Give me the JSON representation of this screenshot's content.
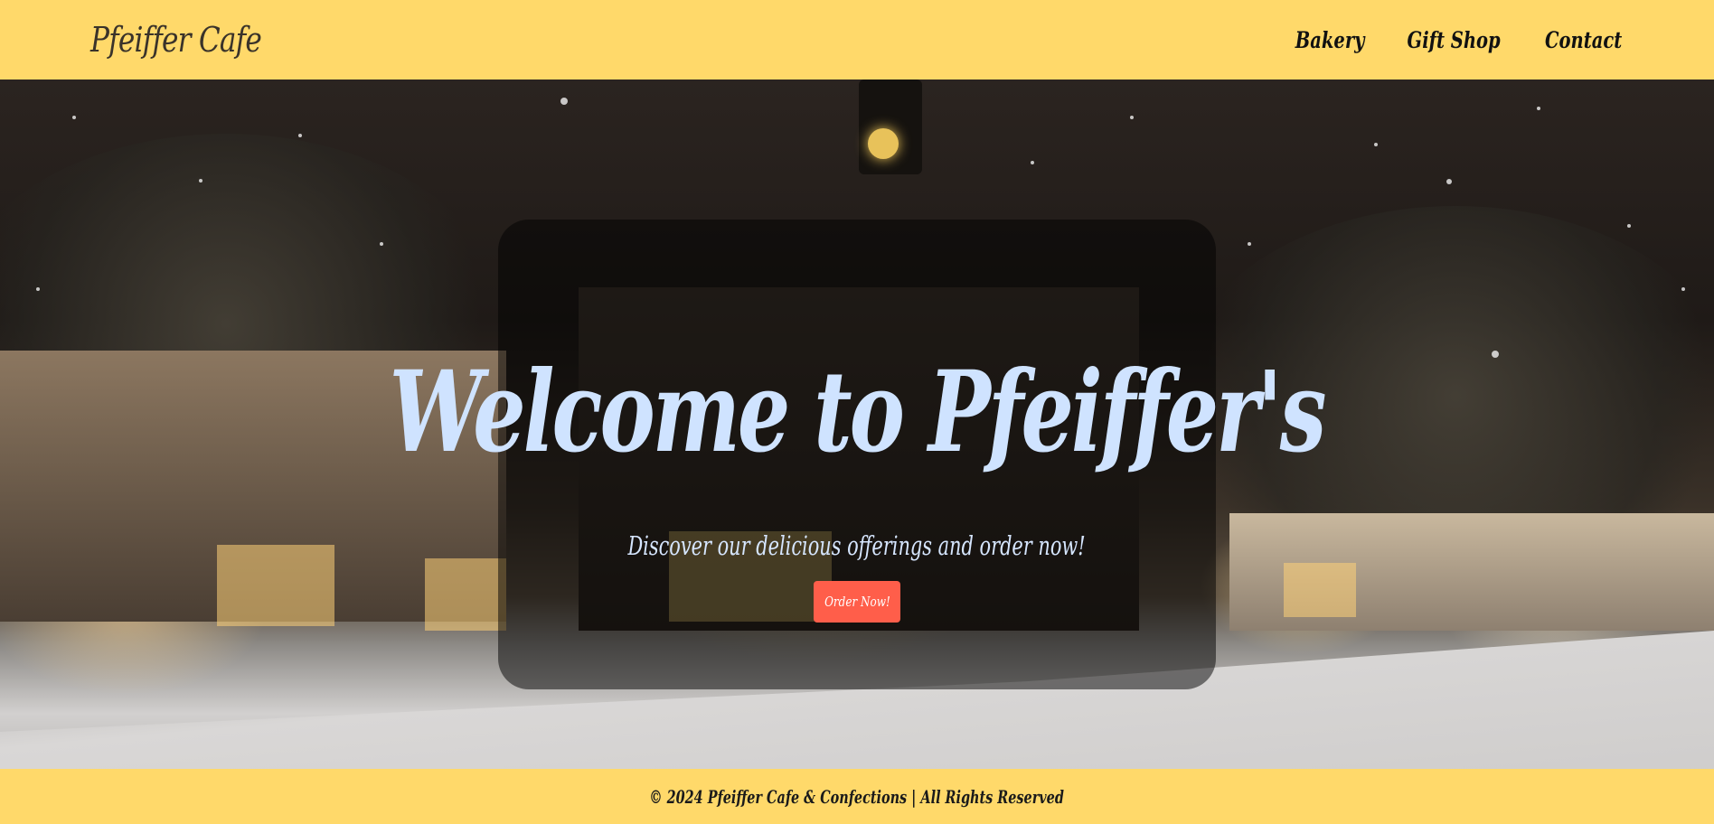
{
  "header": {
    "logo": "Pfeiffer Cafe",
    "nav": [
      "Bakery",
      "Gift Shop",
      "Contact"
    ]
  },
  "hero": {
    "title": "Welcome to Pfeiffer's",
    "subtitle": "Discover our delicious offerings and order now!",
    "cta_label": "Order Now!",
    "background": "snowy-night-street-photo"
  },
  "footer": {
    "copyright": "© 2024 Pfeiffer Cafe & Confections | All Rights Reserved"
  },
  "colors": {
    "header_bg": "#ffd96a",
    "title_color": "#cfe3ff",
    "button_bg": "#ff5e4a"
  }
}
